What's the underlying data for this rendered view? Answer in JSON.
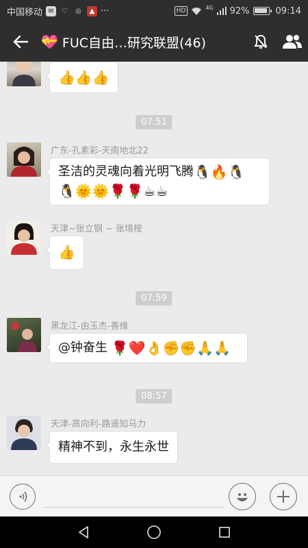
{
  "status_bar": {
    "carrier": "中国移动",
    "more": "···",
    "hd": "HD",
    "network": "4G",
    "battery": "92%",
    "time": "09:14"
  },
  "header": {
    "title": "FUC自由…研究联盟(46)"
  },
  "messages": [
    {
      "kind": "bubble",
      "sender": "",
      "content": "👍👍👍"
    },
    {
      "kind": "time",
      "content": "07:51"
    },
    {
      "kind": "bubble",
      "sender": "广东-孔素彩-天南地北22",
      "line1": "圣洁的灵魂向着光明飞腾",
      "line1_emoji": "🐧🔥🐧",
      "line2": "🐧🌞🌞🌹🌹☕☕"
    },
    {
      "kind": "bubble",
      "sender": "天津~张立钢 ~ 张境桉",
      "content": "👍"
    },
    {
      "kind": "time",
      "content": "07:59"
    },
    {
      "kind": "bubble",
      "sender": "黑龙江-由玉杰-善缘",
      "content": "@钟奋生 ",
      "emoji": "🌹❤️👌✊✊🙏🙏"
    },
    {
      "kind": "time",
      "content": "08:57"
    },
    {
      "kind": "bubble",
      "sender": "天津-高向利-路遥知马力",
      "content": "精神不到，永生永世"
    }
  ],
  "colors": {
    "bar": "#2e2e2e",
    "chat_bg": "#ebebeb",
    "timestamp": "#cecece"
  }
}
